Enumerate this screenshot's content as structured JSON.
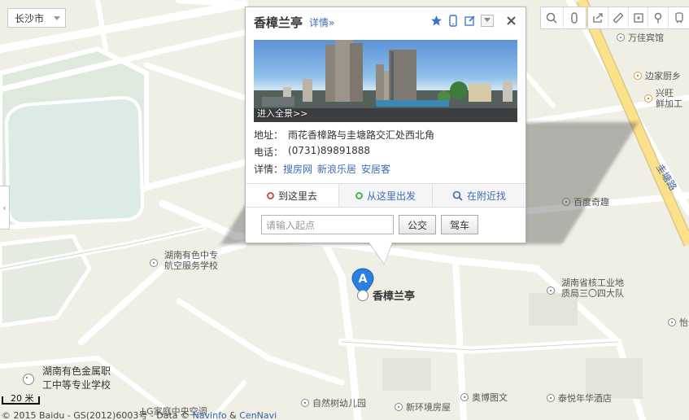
{
  "city_selector": {
    "label": "长沙市"
  },
  "popup": {
    "title": "香樟兰亭",
    "detail_link": "详情»",
    "panorama_label": "进入全景>>",
    "address_label": "地址：",
    "address_value": "雨花香樟路与圭塘路交汇处西北角",
    "phone_label": "电话：",
    "phone_value": "(0731)89891888",
    "details_label": "详情：",
    "detail_sources": [
      "搜房网",
      "新浪乐居",
      "安居客"
    ],
    "tabs": [
      {
        "label": "到这里去",
        "icon": "red-circle-icon"
      },
      {
        "label": "从这里出发",
        "icon": "green-circle-icon"
      },
      {
        "label": "在附近找",
        "icon": "search-icon"
      }
    ],
    "start_placeholder": "请输入起点",
    "bus_button": "公交",
    "drive_button": "驾车"
  },
  "marker": {
    "letter": "A",
    "name": "香樟兰亭"
  },
  "pois": [
    {
      "name": "万佳宾馆"
    },
    {
      "name": "边家厨乡"
    },
    {
      "name": "兴旺"
    },
    {
      "name": "鲜加工"
    },
    {
      "name": "百度奇趣"
    },
    {
      "name": "湖南省核工业地"
    },
    {
      "name": "质局三〇四大队"
    },
    {
      "name": "湖南有色中专"
    },
    {
      "name": "航空服务学校"
    },
    {
      "name": "湖南有色金属职"
    },
    {
      "name": "工中等专业学校"
    },
    {
      "name": "LG家庭中央空调"
    },
    {
      "name": "自然树幼儿园"
    },
    {
      "name": "新环境房屋"
    },
    {
      "name": "奥博图文"
    },
    {
      "name": "泰悦年华酒店"
    },
    {
      "name": "万佳宾馆"
    },
    {
      "name": "怡"
    }
  ],
  "road_label": "圭塘路",
  "scale": {
    "label": "20 米"
  },
  "copyright": {
    "text": "© 2015 Baidu - GS(2012)6003号 - Data ©",
    "navinfo": "Navinfo",
    "amp": "&",
    "cennavi": "CenNavi"
  },
  "colors": {
    "land": "#efefe6",
    "green_area": "#dde9dc",
    "major_road": "#fbe28a",
    "road": "#ffffff",
    "link": "#3c6bb5",
    "marker": "#2c7fe0"
  }
}
